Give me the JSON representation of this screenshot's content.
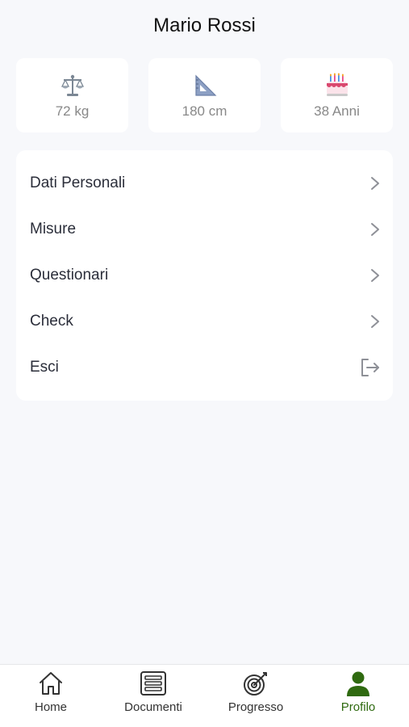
{
  "profile": {
    "name": "Mario Rossi"
  },
  "stats": [
    {
      "icon": "scale-icon",
      "label": "72 kg"
    },
    {
      "icon": "set-square-ruler-icon",
      "label": "180 cm"
    },
    {
      "icon": "birthday-cake-icon",
      "label": "38 Anni"
    }
  ],
  "menu": {
    "items": [
      {
        "label": "Dati Personali",
        "icon": "chevron-right-icon"
      },
      {
        "label": "Misure",
        "icon": "chevron-right-icon"
      },
      {
        "label": "Questionari",
        "icon": "chevron-right-icon"
      },
      {
        "label": "Check",
        "icon": "chevron-right-icon"
      },
      {
        "label": "Esci",
        "icon": "logout-icon"
      }
    ]
  },
  "tabbar": {
    "active_color": "#2f6a10",
    "tabs": [
      {
        "label": "Home",
        "icon": "home-icon"
      },
      {
        "label": "Documenti",
        "icon": "documents-icon"
      },
      {
        "label": "Progresso",
        "icon": "target-icon"
      },
      {
        "label": "Profilo",
        "icon": "user-icon",
        "active": true
      }
    ]
  }
}
